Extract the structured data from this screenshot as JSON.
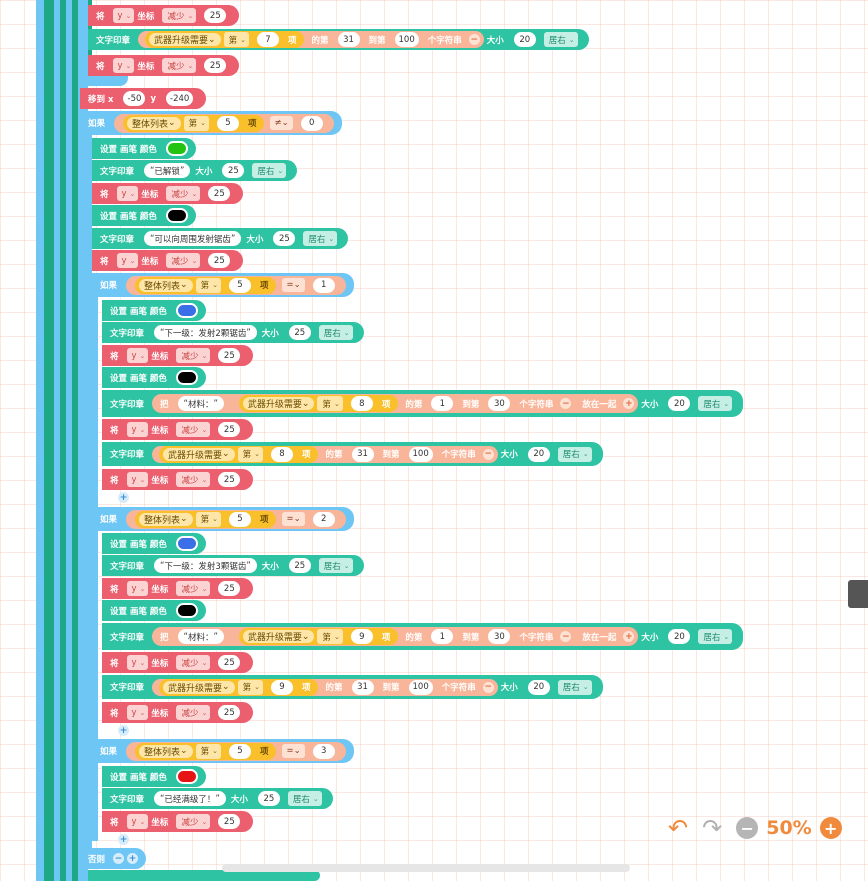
{
  "labels": {
    "set": "将",
    "coord": "坐标",
    "stamp": "文字印章",
    "size": "大小",
    "penColor": "设置 画笔 颜色",
    "moveX": "移到 x",
    "moveY": "y",
    "if": "如果",
    "else": "否则",
    "item": "项",
    "index": "第",
    "sub_of": "的第",
    "sub_to": "到第",
    "sub_chars": "个字符串",
    "join": "把",
    "join_end": "放在一起"
  },
  "vars": {
    "y": "y",
    "dec": "减少",
    "align": "居右",
    "list": "整体列表",
    "upgrade": "武器升级需要"
  },
  "colors": {
    "green": "#22c40f",
    "black": "#000000",
    "blue": "#3b6fe8",
    "red": "#e61414"
  },
  "values": {
    "r0_amt": "25",
    "r1_idx": "7",
    "r1_from": "31",
    "r1_to": "100",
    "r1_size": "20",
    "r2_amt": "25",
    "move_x": "-50",
    "move_y": "-240",
    "if1_idx": "5",
    "if1_op": "≠",
    "if1_val": "0",
    "s1_text": "已解锁",
    "s1_size": "25",
    "s2_amt": "25",
    "s3_text": "可以向周围发射锯齿",
    "s3_size": "25",
    "s4_amt": "25",
    "if2_idx": "5",
    "if2_op": "=",
    "if2_val": "1",
    "a1_text": "下一级：发射2颗锯齿",
    "a1_size": "25",
    "a2_amt": "25",
    "a3_join": "材料：",
    "a3_idx": "8",
    "a3_from": "1",
    "a3_to": "30",
    "a3_size": "20",
    "a4_amt": "25",
    "a5_idx": "8",
    "a5_from": "31",
    "a5_to": "100",
    "a5_size": "20",
    "a6_amt": "25",
    "if3_idx": "5",
    "if3_op": "=",
    "if3_val": "2",
    "b1_text": "下一级：发射3颗锯齿",
    "b1_size": "25",
    "b2_amt": "25",
    "b3_join": "材料：",
    "b3_idx": "9",
    "b3_from": "1",
    "b3_to": "30",
    "b3_size": "20",
    "b4_amt": "25",
    "b5_idx": "9",
    "b5_from": "31",
    "b5_to": "100",
    "b5_size": "20",
    "b6_amt": "25",
    "if4_idx": "5",
    "if4_op": "=",
    "if4_val": "3",
    "c1_text": "已经满级了！",
    "c1_size": "25",
    "c2_amt": "25"
  },
  "toolbar": {
    "zoom": "50%",
    "undo_icon": "undo-arrow-icon",
    "redo_icon": "redo-arrow-icon",
    "zoom_out": "−",
    "zoom_in": "+"
  }
}
